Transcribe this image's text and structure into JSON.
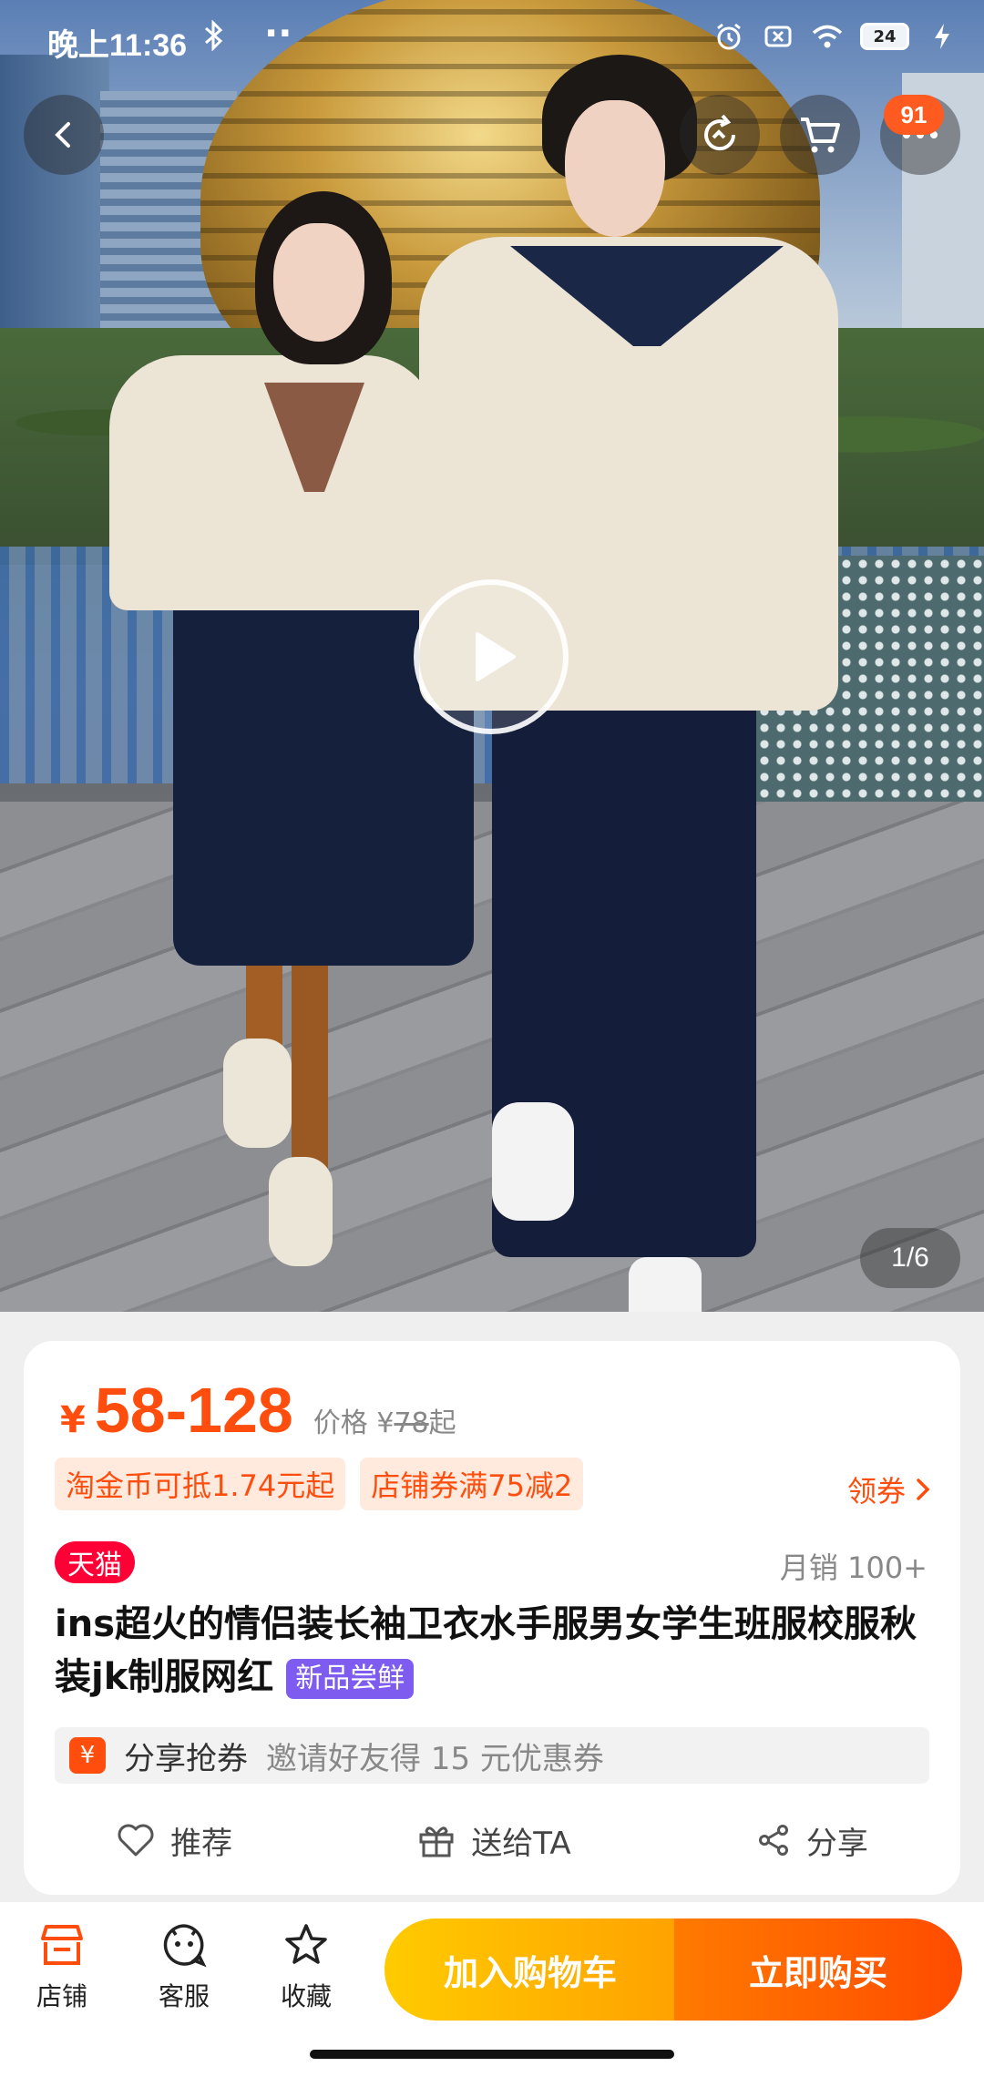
{
  "status_bar": {
    "time": "晚上11:36",
    "battery": "24"
  },
  "nav": {
    "cart_badge": "91"
  },
  "gallery": {
    "pager": "1/6"
  },
  "product": {
    "currency": "¥",
    "price_range": "58-128",
    "orig_label": "价格 ¥",
    "orig_price": "78",
    "orig_suffix": "起",
    "tags": [
      "淘金币可抵1.74元起",
      "店铺券满75减2"
    ],
    "coupon_link": "领券",
    "platform_badge": "天猫",
    "monthly_sales": "月销 100+",
    "title": "ins超火的情侣装长袖卫衣水手服男女学生班服校服秋装jk制服网红",
    "new_tag": "新品尝鲜",
    "share_coupon": {
      "icon": "¥",
      "label": "分享抢券",
      "desc": "邀请好友得 15 元优惠券"
    },
    "actions": {
      "recommend": "推荐",
      "gift": "送给TA",
      "share": "分享"
    }
  },
  "bottom_bar": {
    "shop": "店铺",
    "service": "客服",
    "favorite": "收藏",
    "add_to_cart": "加入购物车",
    "buy_now": "立即购买"
  },
  "colors": {
    "accent": "#ff4d0d",
    "cart_button": "#ffb300",
    "buy_button": "#ff5a00",
    "tmall": "#ff0036",
    "new_tag": "#7f5cf0"
  }
}
